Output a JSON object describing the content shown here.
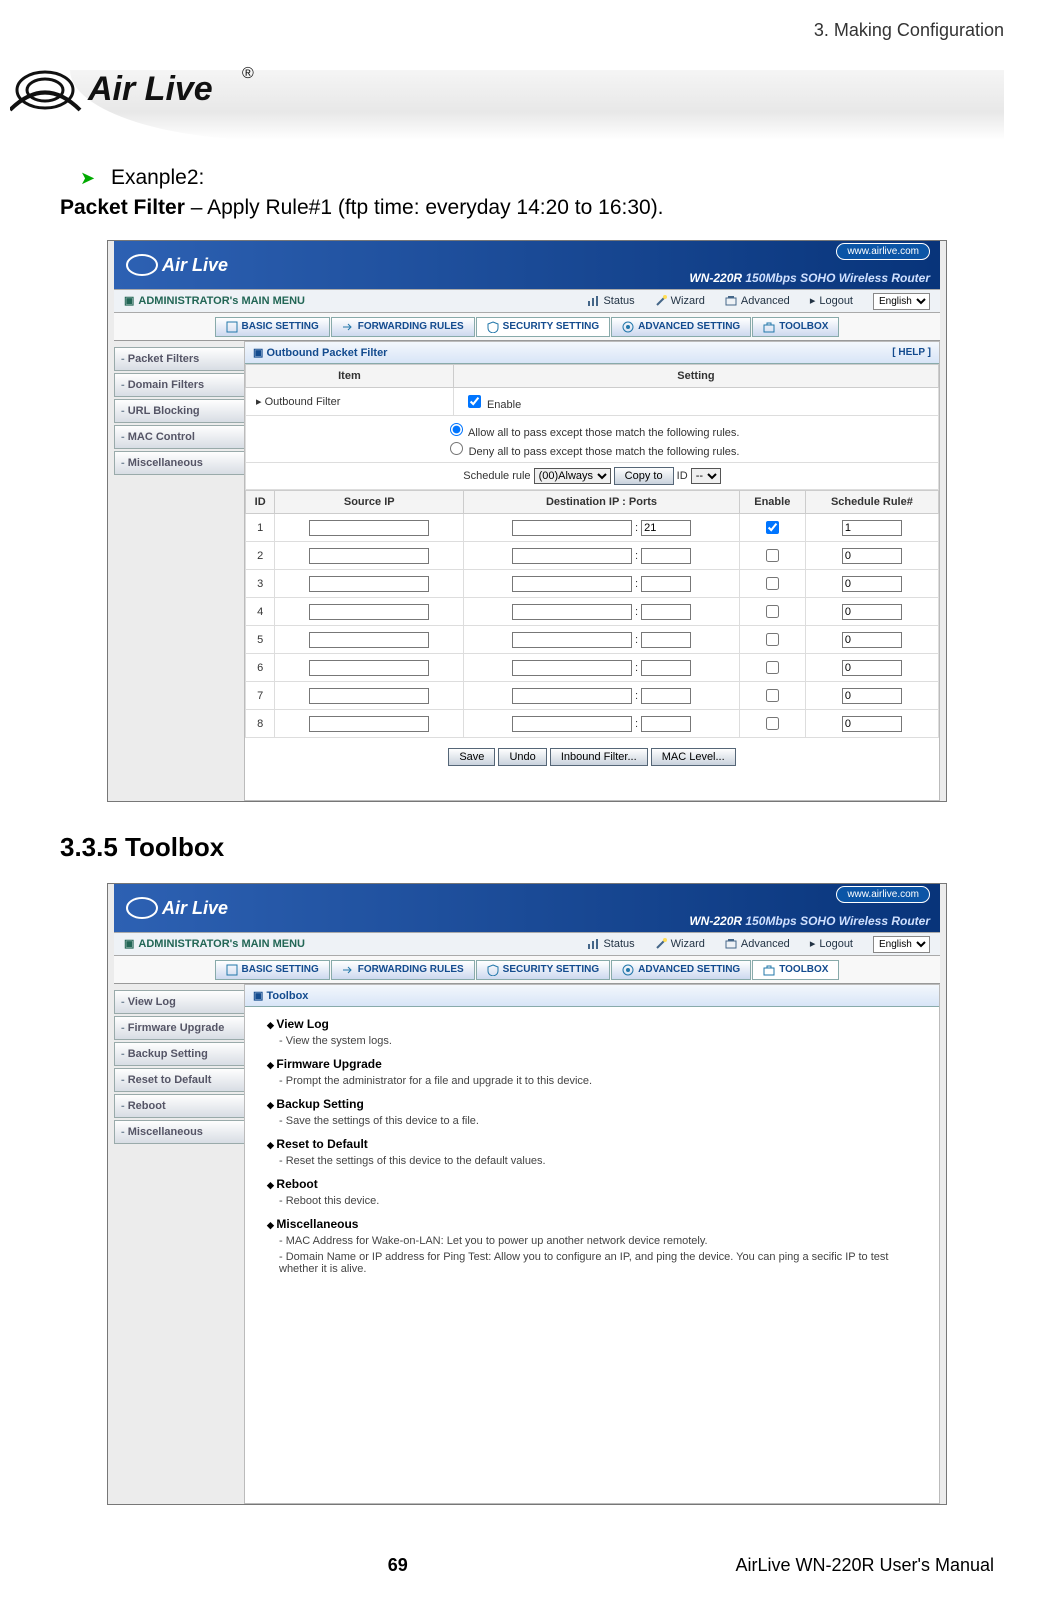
{
  "page": {
    "chapter": "3. Making Configuration",
    "logo_text": "Air Live",
    "example_prefix": "Exanple2:",
    "packet_line_bold": "Packet Filter",
    "packet_line_rest": " – Apply Rule#1 (ftp time: everyday 14:20 to 16:30).",
    "section_heading": "3.3.5 Toolbox",
    "footer_page": "69",
    "footer_manual": "AirLive WN-220R User's Manual"
  },
  "shared": {
    "header_url": "www.airlive.com",
    "header_model_bold": "WN-220R",
    "header_model_rest": " 150Mbps SOHO Wireless Router",
    "admin_menu_title": "ADMINISTRATOR's MAIN MENU",
    "nav_status": "Status",
    "nav_wizard": "Wizard",
    "nav_advanced": "Advanced",
    "nav_logout": "Logout",
    "lang_value": "English",
    "tab_basic": "BASIC SETTING",
    "tab_forward": "FORWARDING RULES",
    "tab_security": "SECURITY SETTING",
    "tab_advanced": "ADVANCED SETTING",
    "tab_toolbox": "TOOLBOX"
  },
  "shot1": {
    "sidebar": [
      "Packet Filters",
      "Domain Filters",
      "URL Blocking",
      "MAC Control",
      "Miscellaneous"
    ],
    "section_title": "Outbound Packet Filter",
    "help": "[ HELP ]",
    "col_item": "Item",
    "col_setting": "Setting",
    "row1_label": "Outbound Filter",
    "row1_enable": "Enable",
    "radio1": "Allow all to pass except those match the following rules.",
    "radio2": "Deny all to pass except those match the following rules.",
    "sched_label": "Schedule rule",
    "sched_value": "(00)Always",
    "copy_btn": "Copy to",
    "id_label": "ID",
    "id_sel": "--",
    "th_id": "ID",
    "th_src": "Source IP",
    "th_dest": "Destination IP : Ports",
    "th_enable": "Enable",
    "th_sr": "Schedule Rule#",
    "rows": [
      {
        "id": "1",
        "src": "",
        "dest_ip": "",
        "dest_port": "21",
        "enable": true,
        "sr": "1"
      },
      {
        "id": "2",
        "src": "",
        "dest_ip": "",
        "dest_port": "",
        "enable": false,
        "sr": "0"
      },
      {
        "id": "3",
        "src": "",
        "dest_ip": "",
        "dest_port": "",
        "enable": false,
        "sr": "0"
      },
      {
        "id": "4",
        "src": "",
        "dest_ip": "",
        "dest_port": "",
        "enable": false,
        "sr": "0"
      },
      {
        "id": "5",
        "src": "",
        "dest_ip": "",
        "dest_port": "",
        "enable": false,
        "sr": "0"
      },
      {
        "id": "6",
        "src": "",
        "dest_ip": "",
        "dest_port": "",
        "enable": false,
        "sr": "0"
      },
      {
        "id": "7",
        "src": "",
        "dest_ip": "",
        "dest_port": "",
        "enable": false,
        "sr": "0"
      },
      {
        "id": "8",
        "src": "",
        "dest_ip": "",
        "dest_port": "",
        "enable": false,
        "sr": "0"
      }
    ],
    "btn_save": "Save",
    "btn_undo": "Undo",
    "btn_inbound": "Inbound Filter...",
    "btn_maclevel": "MAC Level..."
  },
  "shot2": {
    "sidebar": [
      "View Log",
      "Firmware Upgrade",
      "Backup Setting",
      "Reset to Default",
      "Reboot",
      "Miscellaneous"
    ],
    "section_title": "Toolbox",
    "items": [
      {
        "t": "View Log",
        "d": [
          "View the system logs."
        ]
      },
      {
        "t": "Firmware Upgrade",
        "d": [
          "Prompt the administrator for a file and upgrade it to this device."
        ]
      },
      {
        "t": "Backup Setting",
        "d": [
          "Save the settings of this device to a file."
        ]
      },
      {
        "t": "Reset to Default",
        "d": [
          "Reset the settings of this device to the default values."
        ]
      },
      {
        "t": "Reboot",
        "d": [
          "Reboot this device."
        ]
      },
      {
        "t": "Miscellaneous",
        "d": [
          "MAC Address for Wake-on-LAN: Let you to power up another network device remotely.",
          "Domain Name or IP address for Ping Test: Allow you to configure an IP, and ping the device. You can ping a secific IP to test whether it is alive."
        ]
      }
    ]
  }
}
